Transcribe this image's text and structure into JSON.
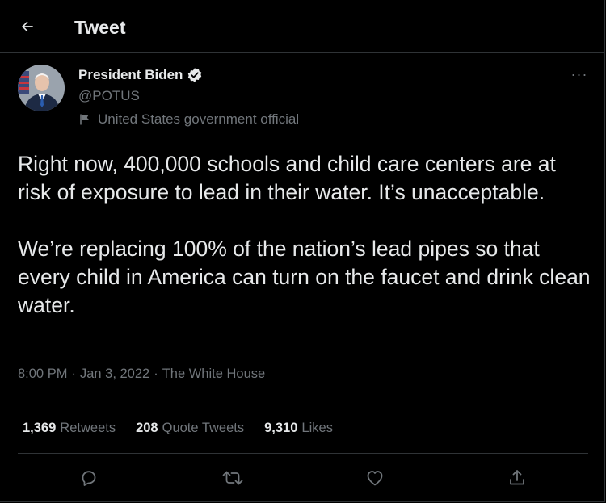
{
  "header": {
    "title": "Tweet",
    "back_icon": "arrow-left-icon"
  },
  "author": {
    "name": "President Biden",
    "handle": "@POTUS",
    "verified_icon": "verified-badge-icon",
    "label_icon": "flag-icon",
    "label": "United States government official"
  },
  "tweet": {
    "text": "Right now, 400,000 schools and child care centers are at risk of exposure to lead in their water. It’s unacceptable.\n\nWe’re replacing 100% of the nation’s lead pipes so that every child in America can turn on the faucet and drink clean water.",
    "time": "8:00 PM",
    "date": "Jan 3, 2022",
    "source": "The White House",
    "sep": "·"
  },
  "stats": {
    "retweets_count": "1,369",
    "retweets_label": "Retweets",
    "quotes_count": "208",
    "quotes_label": "Quote Tweets",
    "likes_count": "9,310",
    "likes_label": "Likes"
  },
  "more": "···",
  "colors": {
    "background": "#000000",
    "text_primary": "#e7e9ea",
    "text_secondary": "#71767b",
    "border": "#2f3336"
  },
  "actions": {
    "reply_icon": "reply-icon",
    "retweet_icon": "retweet-icon",
    "like_icon": "heart-icon",
    "share_icon": "share-icon"
  }
}
